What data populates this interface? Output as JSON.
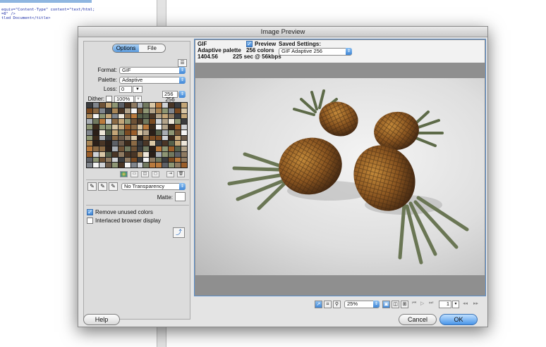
{
  "editor": {
    "code_lines": [
      "equiv=\"Content-Type\" content=\"text/html;",
      "=8\" />",
      "tled Document</title>"
    ]
  },
  "dialog": {
    "title": "Image Preview",
    "tabs": [
      {
        "label": "Options",
        "active": true
      },
      {
        "label": "File",
        "active": false
      }
    ],
    "format_label": "Format:",
    "format_value": "GIF",
    "palette_label": "Palette:",
    "palette_value": "Adaptive",
    "loss_label": "Loss:",
    "loss_value": "0",
    "colors_value": "256",
    "dither_label": "Dither:",
    "dither_value": "100%",
    "dither_count": "256",
    "transparency_value": "No Transparency",
    "matte_label": "Matte:",
    "remove_unused_label": "Remove unused colors",
    "interlaced_label": "Interlaced browser display",
    "help_label": "Help",
    "cancel_label": "Cancel",
    "ok_label": "OK"
  },
  "preview_info": {
    "format": "GIF",
    "palette_text": "Adaptive palette",
    "colors_text": "256 colors",
    "size_text": "1404.56",
    "time_text": "225 sec @ 56kbps",
    "preview_label": "Preview",
    "saved_settings_label": "Saved Settings:",
    "saved_settings_value": "GIF Adaptive 256"
  },
  "toolbar": {
    "zoom_value": "25%",
    "page_value": "1"
  },
  "icons": {
    "pointer": "pointer-icon",
    "crop": "crop-icon",
    "zoom": "zoom-icon",
    "eyedropper": "eyedropper-icon"
  }
}
